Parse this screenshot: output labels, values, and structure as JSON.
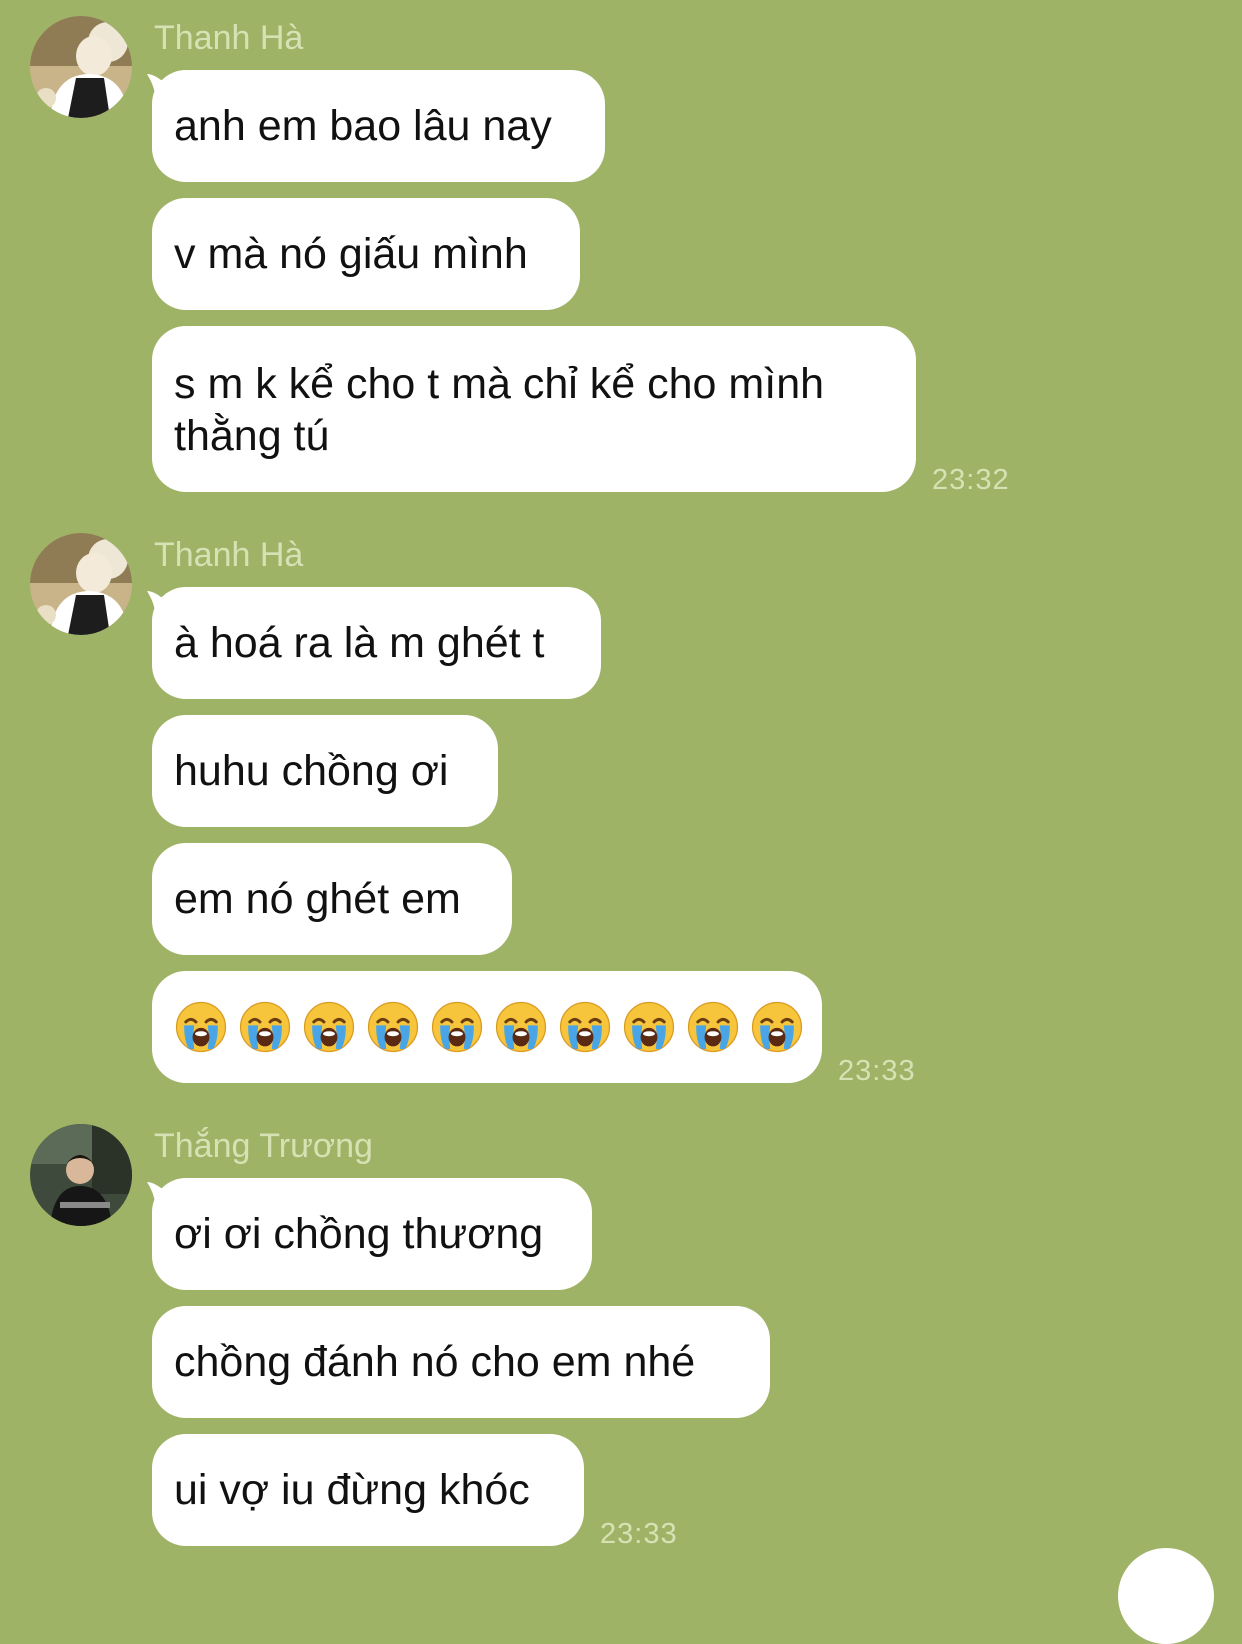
{
  "groups": [
    {
      "sender": "Thanh Hà",
      "avatar": "avatar-thanh-ha",
      "messages": [
        "anh em bao lâu nay",
        "v mà nó giấu mình",
        "s m k kể cho t mà chỉ kể cho mình thằng tú"
      ],
      "time": "23:32"
    },
    {
      "sender": "Thanh Hà",
      "avatar": "avatar-thanh-ha",
      "messages": [
        "à hoá ra là m ghét t",
        "huhu chồng ơi",
        "em nó ghét em"
      ],
      "emoji_message": {
        "icon": "loudly-crying-face-icon",
        "count": 10
      },
      "time": "23:33"
    },
    {
      "sender": "Thắng Trương",
      "avatar": "avatar-thang-truong",
      "messages": [
        "ơi ơi chồng thương",
        "chồng đánh nó cho em nhé",
        "ui vợ iu đừng khóc"
      ],
      "time": "23:33"
    }
  ],
  "colors": {
    "background": "#9fb366",
    "bubble": "#ffffff",
    "meta_text": "#d6e2b4",
    "message_text": "#111111"
  }
}
